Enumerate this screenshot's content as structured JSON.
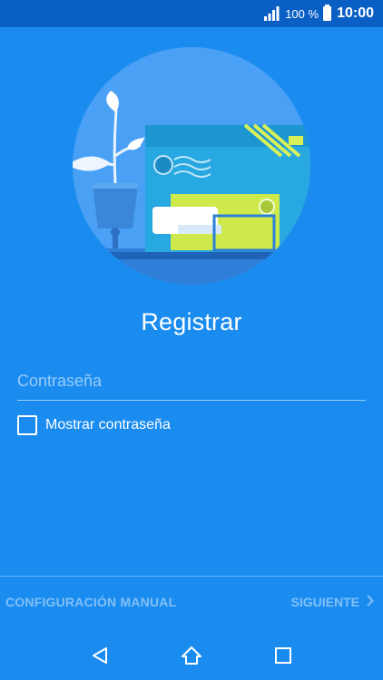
{
  "status_bar": {
    "battery_percent": "100 %",
    "time": "10:00"
  },
  "screen": {
    "title": "Registrar",
    "password_placeholder": "Contraseña",
    "show_password_label": "Mostrar contraseña",
    "show_password_checked": false
  },
  "footer": {
    "manual_config_label": "CONFIGURACIÓN MANUAL",
    "next_label": "SIGUIENTE"
  },
  "icons": {
    "signal": "signal-icon",
    "battery": "battery-icon",
    "back": "back-icon",
    "home": "home-icon",
    "recents": "recents-icon",
    "next": "chevron-right-icon"
  },
  "colors": {
    "background": "#1a8cf0",
    "status_bar": "#0a5fc4",
    "illustration_circle": "#4aa0f5"
  }
}
